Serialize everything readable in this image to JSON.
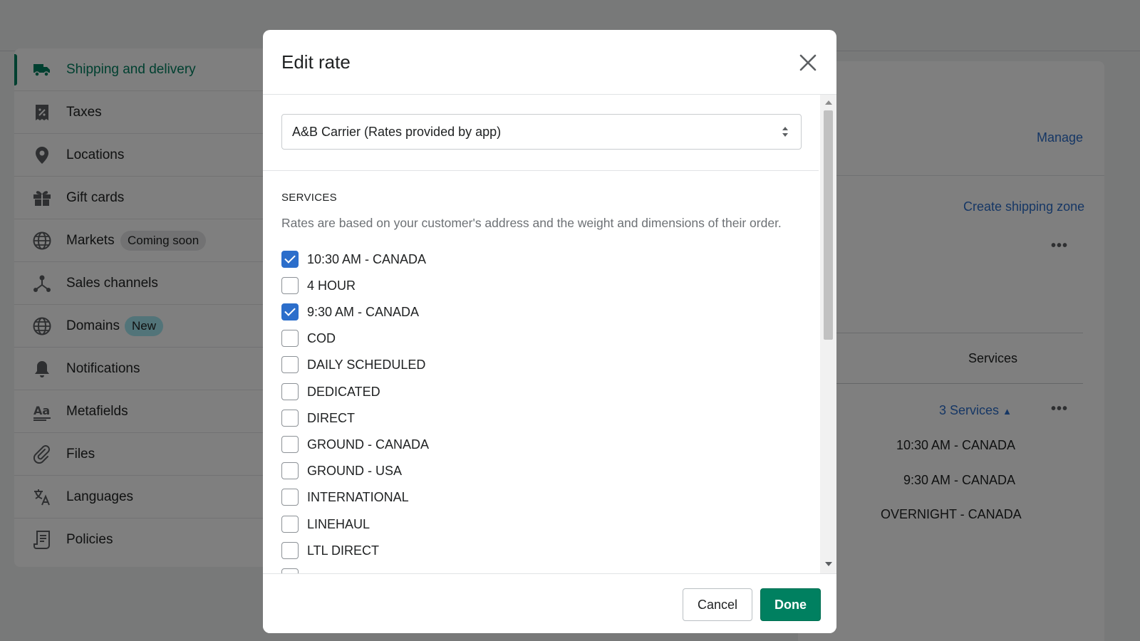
{
  "sidebar": {
    "items": [
      {
        "label": "Shipping and delivery",
        "icon": "truck-icon",
        "active": true
      },
      {
        "label": "Taxes",
        "icon": "tax-receipt-icon"
      },
      {
        "label": "Locations",
        "icon": "map-pin-icon"
      },
      {
        "label": "Gift cards",
        "icon": "gift-icon"
      },
      {
        "label": "Markets",
        "icon": "globe-icon",
        "badge": "Coming soon"
      },
      {
        "label": "Sales channels",
        "icon": "sales-channels-icon"
      },
      {
        "label": "Domains",
        "icon": "domain-globe-icon",
        "badge": "New"
      },
      {
        "label": "Notifications",
        "icon": "bell-icon"
      },
      {
        "label": "Metafields",
        "icon": "metafields-icon"
      },
      {
        "label": "Files",
        "icon": "paperclip-icon"
      },
      {
        "label": "Languages",
        "icon": "translate-icon"
      },
      {
        "label": "Policies",
        "icon": "policy-document-icon"
      }
    ]
  },
  "background": {
    "manage_link": "Manage",
    "create_zone_link": "Create shipping zone",
    "services_header": "Services",
    "services_toggle": "3 Services",
    "services_list": [
      "10:30 AM - CANADA",
      "9:30 AM - CANADA",
      "OVERNIGHT - CANADA"
    ]
  },
  "modal": {
    "title": "Edit rate",
    "carrier_select": "A&B Carrier (Rates provided by app)",
    "services_heading": "SERVICES",
    "services_description": "Rates are based on your customer's address and the weight and dimensions of their order.",
    "services": [
      {
        "label": "10:30 AM - CANADA",
        "checked": true
      },
      {
        "label": "4 HOUR",
        "checked": false
      },
      {
        "label": "9:30 AM - CANADA",
        "checked": true
      },
      {
        "label": "COD",
        "checked": false
      },
      {
        "label": "DAILY SCHEDULED",
        "checked": false
      },
      {
        "label": "DEDICATED",
        "checked": false
      },
      {
        "label": "DIRECT",
        "checked": false
      },
      {
        "label": "GROUND - CANADA",
        "checked": false
      },
      {
        "label": "GROUND - USA",
        "checked": false
      },
      {
        "label": "INTERNATIONAL",
        "checked": false
      },
      {
        "label": "LINEHAUL",
        "checked": false
      },
      {
        "label": "LTL DIRECT",
        "checked": false
      }
    ],
    "cancel_label": "Cancel",
    "done_label": "Done"
  },
  "colors": {
    "accent": "#008060",
    "link": "#2c6ecb",
    "checkbox_checked": "#2c6ecb"
  }
}
